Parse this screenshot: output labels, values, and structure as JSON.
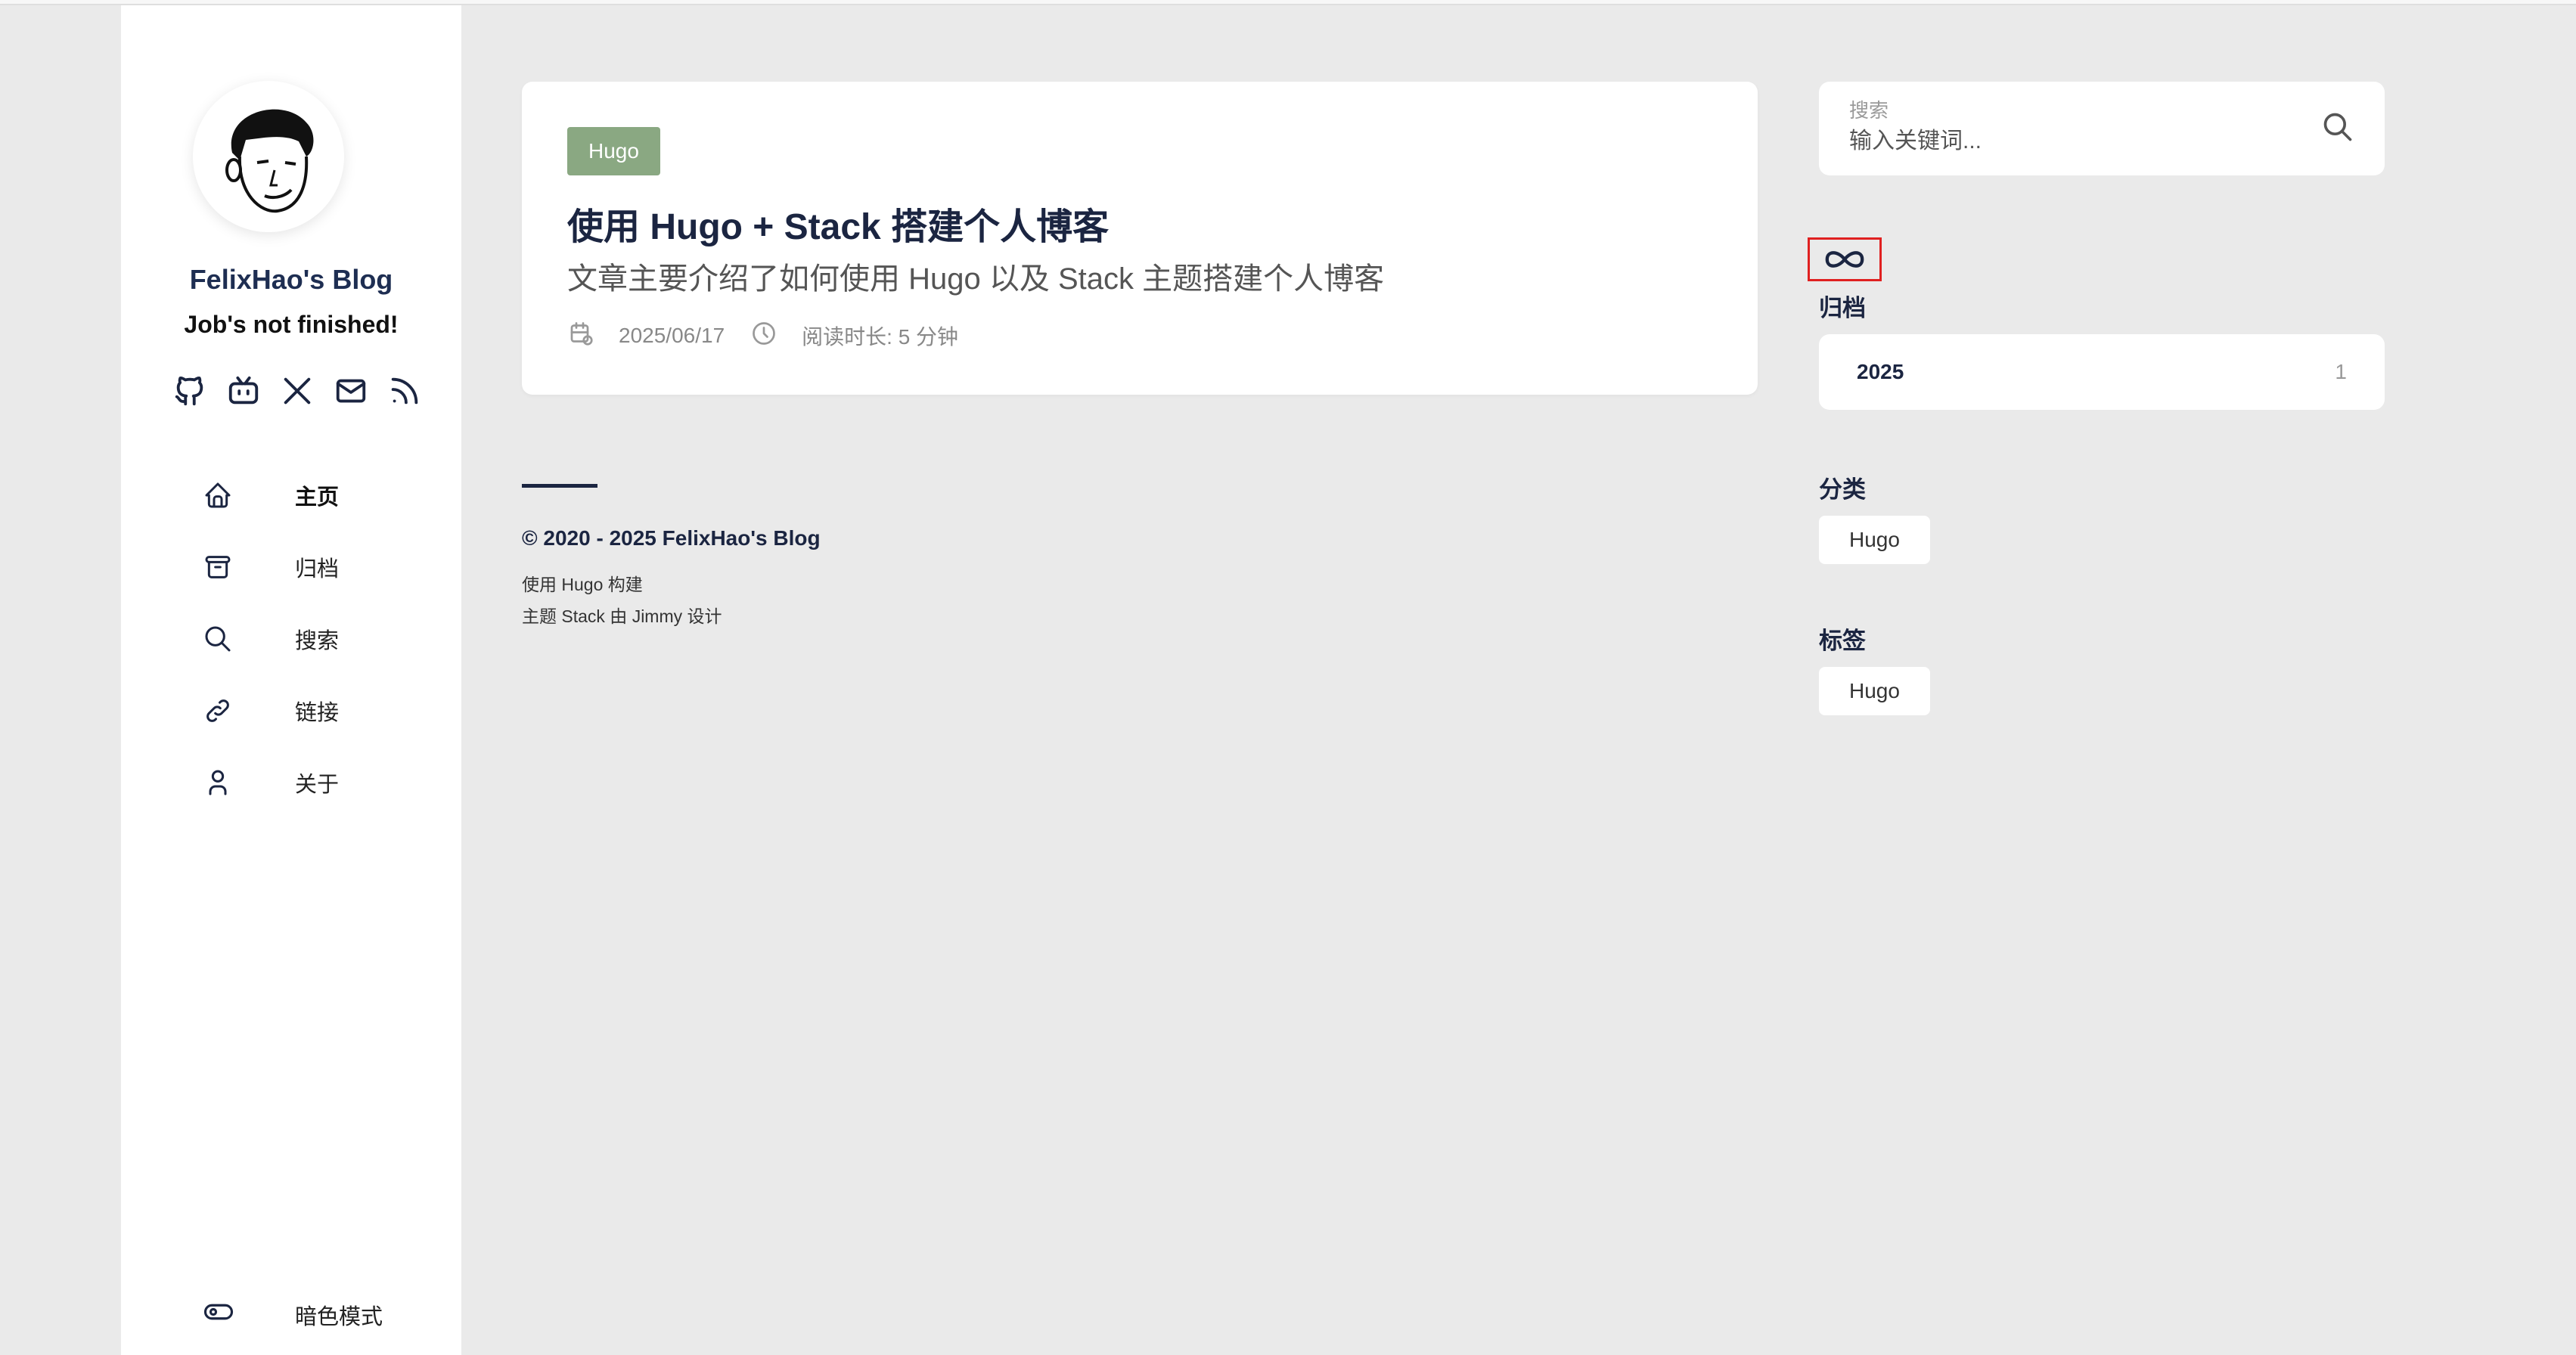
{
  "sidebar": {
    "site_name": "FelixHao's Blog",
    "site_description": "Job's not finished!",
    "social_links": [
      "github-icon",
      "bilibili-icon",
      "x-icon",
      "mail-icon",
      "rss-icon"
    ],
    "menu": [
      {
        "label": "主页",
        "icon": "home-icon",
        "active": true
      },
      {
        "label": "归档",
        "icon": "archive-icon"
      },
      {
        "label": "搜索",
        "icon": "search-icon"
      },
      {
        "label": "链接",
        "icon": "link-icon"
      },
      {
        "label": "关于",
        "icon": "user-icon"
      }
    ],
    "dark_mode_label": "暗色模式"
  },
  "article": {
    "category": "Hugo",
    "title": "使用 Hugo + Stack 搭建个人博客",
    "subtitle": "文章主要介绍了如何使用 Hugo 以及 Stack 主题搭建个人博客",
    "date": "2025/06/17",
    "read_time": "阅读时长: 5 分钟"
  },
  "footer": {
    "copyright": "© 2020 - 2025 FelixHao's Blog",
    "powered_by": "使用 Hugo 构建",
    "theme": "主题 Stack 由 Jimmy 设计"
  },
  "right": {
    "search": {
      "label": "搜索",
      "placeholder": "输入关键词..."
    },
    "archives": {
      "title": "归档",
      "items": [
        {
          "year": "2025",
          "count": "1"
        }
      ]
    },
    "categories": {
      "title": "分类",
      "items": [
        "Hugo"
      ]
    },
    "tags": {
      "title": "标签",
      "items": [
        "Hugo"
      ]
    }
  },
  "colors": {
    "accent": "#1b2541",
    "tag_badge": "#8aa882",
    "highlight_box": "#e02020",
    "background": "#eaeaea"
  }
}
